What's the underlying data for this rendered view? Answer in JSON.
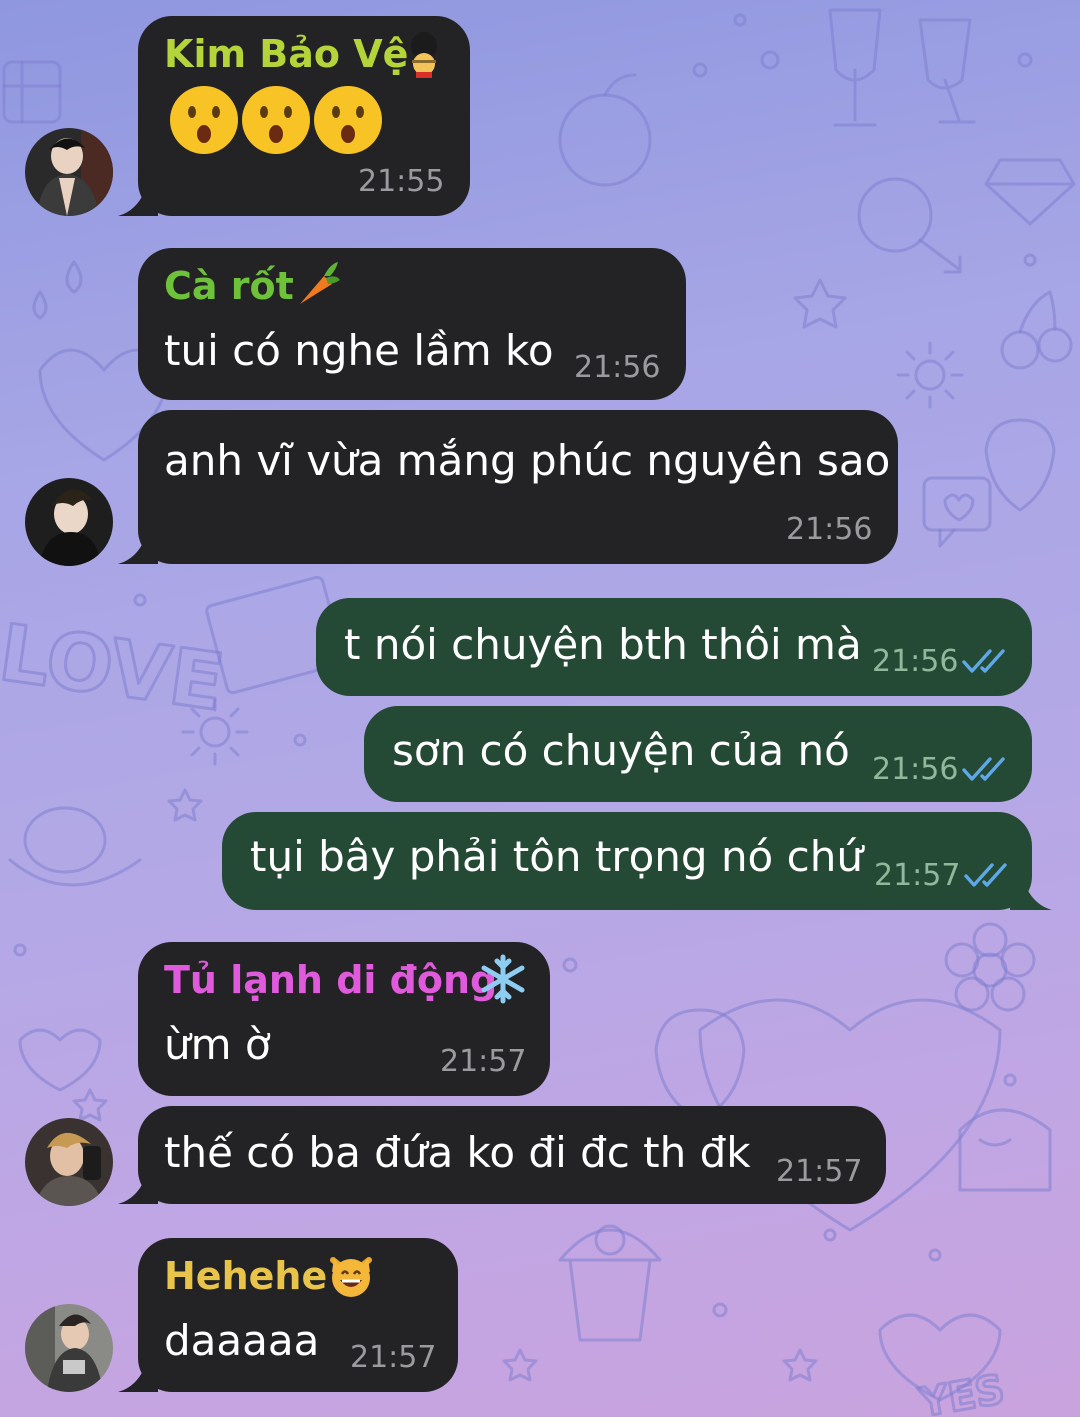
{
  "colors": {
    "incoming_bubble": "#232326",
    "outgoing_bubble": "#244a35",
    "name_kim": "#b5d43a",
    "name_carrot": "#6ec23a",
    "name_tulanh": "#e05adc",
    "name_hehehe": "#e8c44a",
    "read_ticks": "#5fa8e8"
  },
  "messages": [
    {
      "sender": "Kim Bảo Vệ",
      "sender_emoji": "guard-emoji",
      "text": "",
      "emojis": [
        "hushed-face",
        "hushed-face",
        "hushed-face"
      ],
      "time": "21:55"
    },
    {
      "sender": "Cà rốt",
      "sender_emoji": "carrot-emoji",
      "text": "tui có nghe lầm ko",
      "time": "21:56"
    },
    {
      "sender": "",
      "text": "anh vĩ vừa mắng phúc nguyên sao",
      "time": "21:56"
    },
    {
      "sender": "",
      "text": "t nói chuyện bth thôi mà",
      "time": "21:56",
      "outgoing": true
    },
    {
      "sender": "",
      "text": "sơn có chuyện của nó",
      "time": "21:56",
      "outgoing": true
    },
    {
      "sender": "",
      "text": "tụi bây phải tôn trọng nó chứ",
      "time": "21:57",
      "outgoing": true
    },
    {
      "sender": "Tủ lạnh di động",
      "sender_emoji": "snowflake-emoji",
      "text": "ừm ờ",
      "time": "21:57"
    },
    {
      "sender": "",
      "text": "thế có ba đứa ko đi đc th đk",
      "time": "21:57"
    },
    {
      "sender": "Hehehe",
      "sender_emoji": "grinning-cat-emoji",
      "text": "daaaaa",
      "time": "21:57"
    }
  ]
}
